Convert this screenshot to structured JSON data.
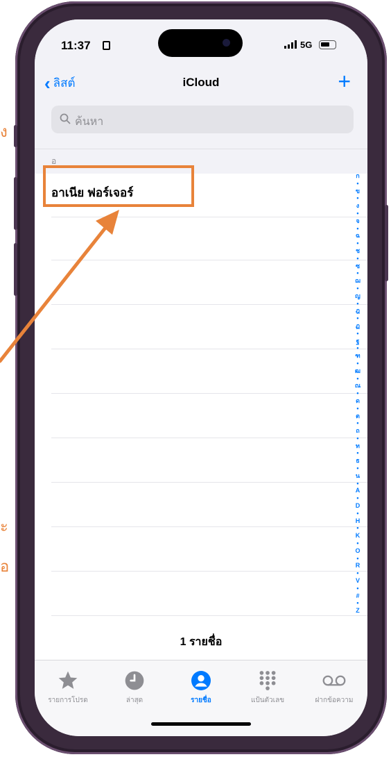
{
  "side_texts": {
    "top": "ง",
    "mid1": "ะ",
    "mid2": "อ"
  },
  "status_bar": {
    "time": "11:37",
    "network": "5G"
  },
  "nav": {
    "back_label": "ลิสต์",
    "title": "iCloud",
    "add_symbol": "+"
  },
  "search": {
    "placeholder": "ค้นหา"
  },
  "section_header": "อ",
  "contacts": [
    {
      "name": "อาเนีย ฟอร์เจอร์"
    }
  ],
  "index_letters": [
    "ก",
    "•",
    "ข",
    "•",
    "ง",
    "•",
    "จ",
    "•",
    "ฉ",
    "•",
    "ช",
    "•",
    "ซ",
    "•",
    "ฌ",
    "•",
    "ญ",
    "•",
    "ฎ",
    "•",
    "ฏ",
    "•",
    "ฐ",
    "•",
    "ฑ",
    "•",
    "ฒ",
    "•",
    "ณ",
    "•",
    "ด",
    "•",
    "ต",
    "•",
    "ถ",
    "•",
    "ท",
    "•",
    "ธ",
    "•",
    "น",
    "•",
    "A",
    "•",
    "D",
    "•",
    "H",
    "•",
    "K",
    "•",
    "O",
    "•",
    "R",
    "•",
    "V",
    "•",
    "#",
    "•",
    "Z"
  ],
  "contact_count": "1 รายชื่อ",
  "tabs": [
    {
      "label": "รายการโปรด",
      "icon": "star-icon",
      "active": false
    },
    {
      "label": "ล่าสุด",
      "icon": "clock-icon",
      "active": false
    },
    {
      "label": "รายชื่อ",
      "icon": "person-circle-icon",
      "active": true
    },
    {
      "label": "แป้นตัวเลข",
      "icon": "keypad-icon",
      "active": false
    },
    {
      "label": "ฝากข้อความ",
      "icon": "voicemail-icon",
      "active": false
    }
  ],
  "colors": {
    "accent": "#007aff",
    "annotation": "#e8833a",
    "frame": "#3a2a3d"
  }
}
